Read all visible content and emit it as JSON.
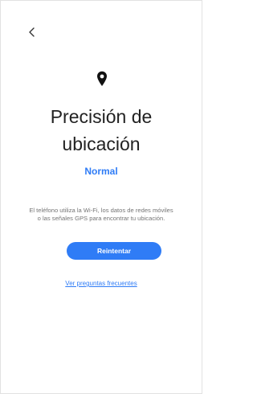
{
  "header": {
    "back_icon": "chevron-left-icon"
  },
  "main": {
    "icon": "location-pin-icon",
    "title_line1": "Precisión de",
    "title_line2": "ubicación",
    "status_text": "Normal",
    "description_line1": "El teléfono utiliza la Wi-Fi, los datos de redes móviles",
    "description_line2": "o las señales GPS para encontrar tu ubicación.",
    "retry_label": "Reintentar",
    "faq_link": "Ver preguntas frecuentes"
  },
  "colors": {
    "accent": "#2f7cf6",
    "title_text": "#222222",
    "body_text": "#757575",
    "background": "#ffffff"
  }
}
